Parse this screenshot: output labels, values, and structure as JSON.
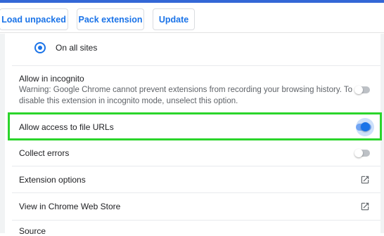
{
  "toolbar": {
    "load_unpacked_label": "Load unpacked",
    "pack_extension_label": "Pack extension",
    "update_label": "Update"
  },
  "site_access": {
    "option_label": "On all sites",
    "selected": true
  },
  "incognito": {
    "label": "Allow in incognito",
    "warning": "Warning: Google Chrome cannot prevent extensions from recording your browsing history. To disable this extension in incognito mode, unselect this option.",
    "enabled": false
  },
  "file_urls": {
    "label": "Allow access to file URLs",
    "enabled": true
  },
  "collect_errors": {
    "label": "Collect errors",
    "enabled": false
  },
  "extension_options": {
    "label": "Extension options",
    "icon": "open-in-new-icon"
  },
  "web_store": {
    "label": "View in Chrome Web Store",
    "icon": "open-in-new-icon"
  },
  "source": {
    "label": "Source"
  },
  "colors": {
    "accent": "#1a73e8",
    "highlight": "#2bd52b",
    "top_strip": "#3367d6"
  }
}
